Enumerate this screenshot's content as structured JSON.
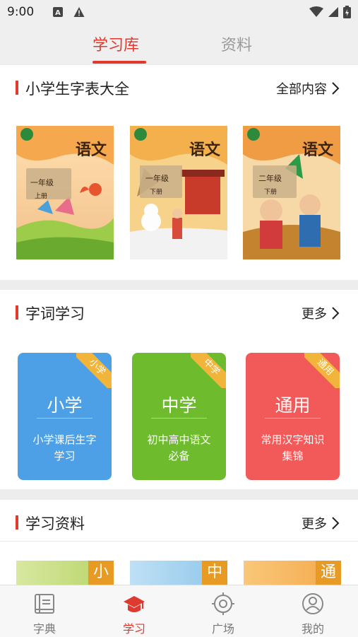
{
  "status_bar": {
    "time": "9:00"
  },
  "top_tabs": [
    {
      "label": "学习库",
      "active": true
    },
    {
      "label": "资料",
      "active": false
    }
  ],
  "section1": {
    "title": "小学生字表大全",
    "more": "全部内容",
    "books": [
      {
        "title": "语文",
        "grade": "一年级",
        "volume": "上册"
      },
      {
        "title": "语文",
        "grade": "一年级",
        "volume": "下册"
      },
      {
        "title": "语文",
        "grade": "二年级",
        "volume": "下册"
      }
    ]
  },
  "section2": {
    "title": "字词学习",
    "more": "更多",
    "cards": [
      {
        "title": "小学",
        "ribbon": "小学",
        "sub1": "小学课后生字",
        "sub2": "学习",
        "color": "#4da0e6"
      },
      {
        "title": "中学",
        "ribbon": "中学",
        "sub1": "初中高中语文",
        "sub2": "必备",
        "color": "#6ebc2e"
      },
      {
        "title": "通用",
        "ribbon": "通用",
        "sub1": "常用汉字知识",
        "sub2": "集锦",
        "color": "#f25a5a"
      }
    ]
  },
  "section3": {
    "title": "学习资料",
    "more": "更多",
    "items": [
      {
        "tag": "小"
      },
      {
        "tag": "中"
      },
      {
        "tag": "通"
      }
    ]
  },
  "bottom_nav": [
    {
      "label": "字典",
      "icon": "book-icon",
      "active": false
    },
    {
      "label": "学习",
      "icon": "graduation-cap-icon",
      "active": true
    },
    {
      "label": "广场",
      "icon": "target-icon",
      "active": false
    },
    {
      "label": "我的",
      "icon": "user-icon",
      "active": false
    }
  ],
  "colors": {
    "accent": "#e03a2e",
    "ribbon": "#f2b53b"
  }
}
